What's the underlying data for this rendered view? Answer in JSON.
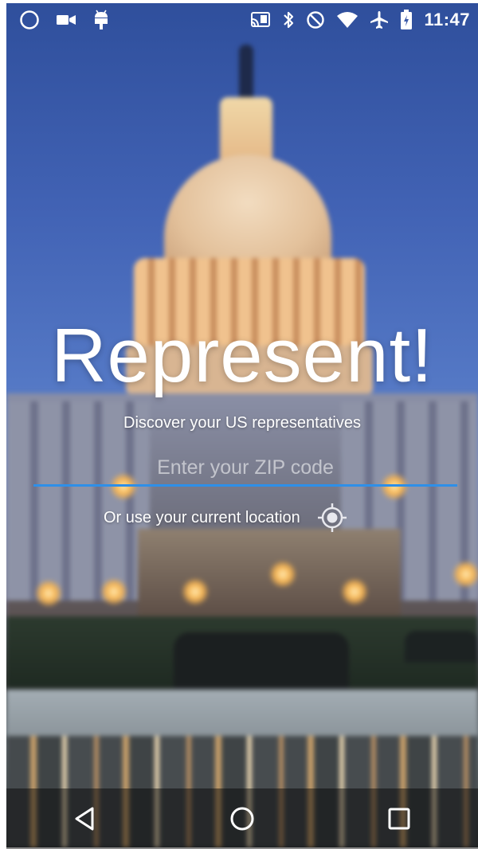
{
  "status_bar": {
    "time": "11:47",
    "left_icons": [
      "circle-notification-icon",
      "video-camera-icon",
      "android-debug-icon"
    ],
    "right_icons": [
      "cast-icon",
      "bluetooth-icon",
      "do-not-disturb-icon",
      "wifi-icon",
      "airplane-mode-icon",
      "battery-charging-icon"
    ]
  },
  "main": {
    "title": "Represent!",
    "subtitle": "Discover your US representatives",
    "zip_input": {
      "placeholder": "Enter your ZIP code",
      "value": ""
    },
    "location_label": "Or use your current location",
    "location_icon": "crosshair-location-icon"
  },
  "colors": {
    "input_underline": "#2e8fe8",
    "text": "#ffffff"
  },
  "nav_bar": {
    "buttons": [
      "back-icon",
      "home-icon",
      "recents-icon"
    ]
  }
}
